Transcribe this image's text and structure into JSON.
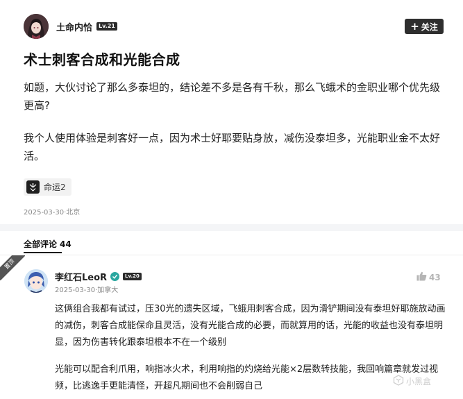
{
  "post": {
    "author": {
      "name": "土命内恰",
      "level": "Lv.21"
    },
    "follow_label": "关注",
    "title": "术士刺客合成和光能合成",
    "paragraphs": [
      "如题，大伙讨论了那么多泰坦的，结论差不多是各有千秋，那么飞蛾术的金职业哪个优先级更高?",
      "我个人使用体验是刺客好一点，因为术士好耶要贴身放，减伤没泰坦多，光能职业金不太好活。"
    ],
    "tag": {
      "icon": "destiny-game-icon",
      "label": "命运2"
    },
    "meta": "2025-03-30·北京"
  },
  "comments": {
    "header_label": "全部评论",
    "count": "44",
    "pinned_label": "置顶",
    "items": [
      {
        "author": "李红石LeoR",
        "level": "Lv.20",
        "meta": "2025-03-30·加拿大",
        "likes": "43",
        "paragraphs": [
          "这俩组合我都有试过，压30光的遗失区域，飞蛾用刺客合成，因为滑铲期间没有泰坦好耶施放动画的减伤，刺客合成能保命且灵活，没有光能合成的必要，而就算用的话，光能的收益也没有泰坦明显，因为伤害转化跟泰坦根本不在一个级别",
          "光能可以配合利爪用，响指冰火术，利用响指的灼烧给光能×2层数转技能，我回响篇章就发过视频，比逃逸手更能清怪，开超凡期间也不会削弱自己"
        ]
      }
    ]
  },
  "watermark": "小黑盒"
}
